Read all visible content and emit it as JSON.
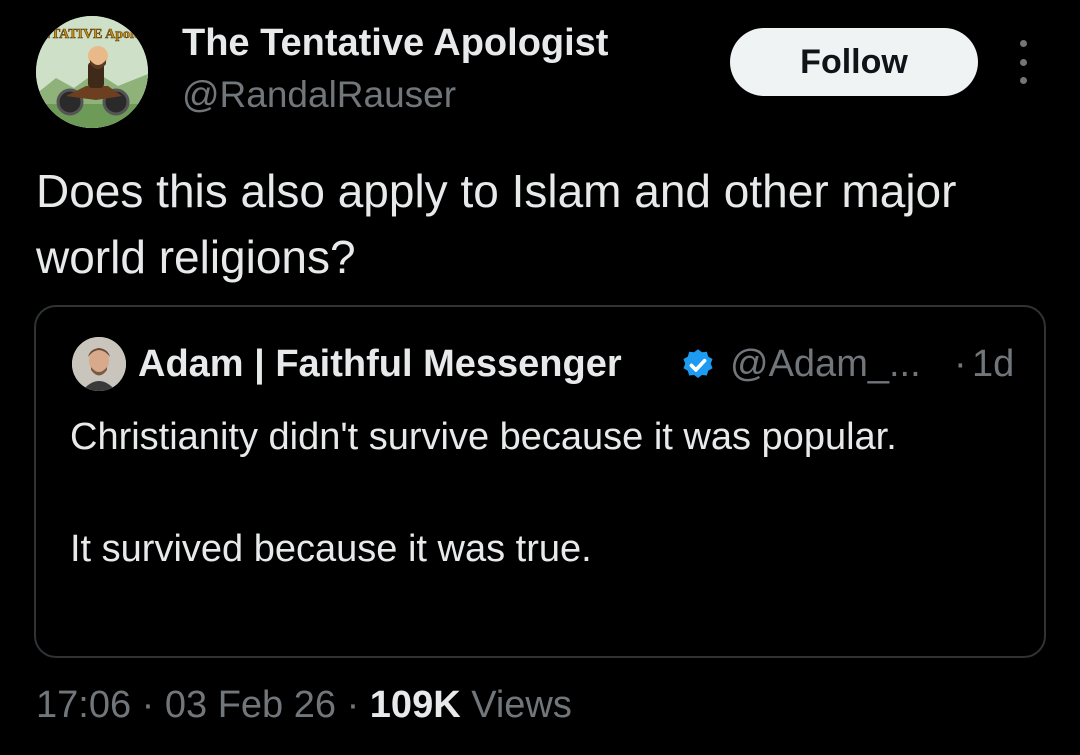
{
  "tweet": {
    "author": {
      "avatar_label": "TENTATIVE Apologist",
      "display_name": "The Tentative Apologist",
      "handle": "@RandalRauser"
    },
    "follow_label": "Follow",
    "more_icon": "more-options-icon",
    "text": "Does this also apply to Islam and other major world religions?",
    "quote": {
      "display_name": "Adam | Faithful Messenger",
      "verified_icon": "verified-badge-icon",
      "handle": "@Adam_...",
      "separator": "·",
      "time": "1d",
      "paragraphs": [
        "Christianity didn't survive because it was popular.",
        "It survived because it was true."
      ]
    },
    "meta": {
      "time": "17:06",
      "sep1": " · ",
      "date": "03 Feb 26",
      "sep2": " · ",
      "views_count": "109K",
      "views_label": " Views"
    }
  },
  "colors": {
    "background": "#000000",
    "primary_text": "#e7e9ea",
    "secondary_text": "#71767b",
    "border": "#2f3336",
    "verified": "#1d9bf0",
    "follow_bg": "#eff3f4"
  }
}
